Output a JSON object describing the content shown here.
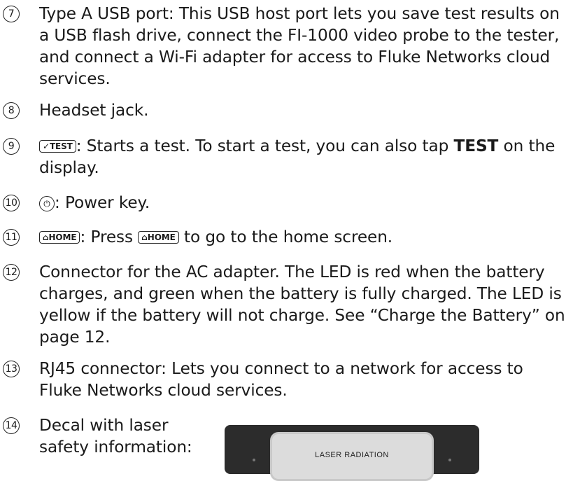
{
  "items": [
    {
      "n": "7",
      "text": "Type A USB port: This USB host port lets you save test results on a USB flash drive, connect the FI-1000 video probe to the tester, and connect a Wi-Fi adapter for access to Fluke Networks cloud services."
    },
    {
      "n": "8",
      "text": "Headset jack."
    },
    {
      "n": "9",
      "key": "✓TEST",
      "rest": ": Starts a test. To start a test, you can also tap ",
      "bold": "TEST",
      "rest2": " on the display."
    },
    {
      "n": "10",
      "power": "⏻",
      "rest": ": Power key."
    },
    {
      "n": "11",
      "key": "⌂HOME",
      "rest": ": Press ",
      "key2": "⌂HOME",
      "rest2": " to go to the home screen."
    },
    {
      "n": "12",
      "text": "Connector for the AC adapter. The LED is red when the battery charges, and green when the battery is fully charged. The LED is yellow if the battery will not charge. See “Charge the Battery” on page 12."
    },
    {
      "n": "13",
      "text": "RJ45 connector: Lets you connect to a network for access to Fluke Networks cloud services."
    },
    {
      "n": "14",
      "text": "Decal with laser safety information:"
    }
  ],
  "decal": {
    "label": "LASER RADIATION"
  }
}
